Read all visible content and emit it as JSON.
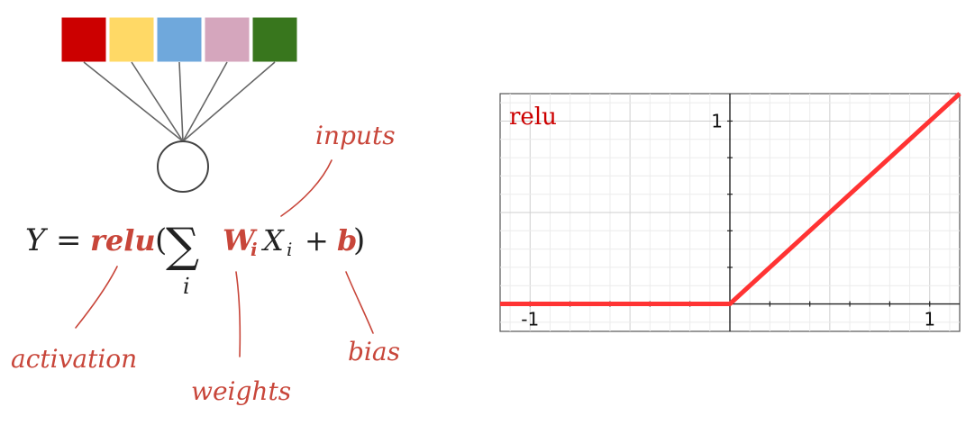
{
  "neuron": {
    "input_colors": [
      "#cc0000",
      "#ffd966",
      "#6fa8dc",
      "#d5a6bd",
      "#38761d"
    ],
    "line_color": "#666666",
    "node_stroke": "#444444"
  },
  "formula": {
    "lhs": "Y",
    "equals": "=",
    "activation_fn": "relu",
    "open_paren": "(",
    "sum_symbol": "∑",
    "sum_index": "i",
    "weight": "W",
    "weight_sub": "i",
    "input": "X",
    "input_sub": "i",
    "plus": "+",
    "bias": "b",
    "close_paren": ")",
    "highlight_color": "#c8463a"
  },
  "annotations": {
    "inputs": "inputs",
    "activation": "activation",
    "weights": "weights",
    "bias": "bias"
  },
  "chart_data": {
    "type": "line",
    "title": "relu",
    "title_color": "#cc0000",
    "line_color": "#ff3333",
    "xlim": [
      -1.15,
      1.15
    ],
    "ylim": [
      -0.15,
      1.15
    ],
    "x_tick_labels": [
      "-1",
      "1"
    ],
    "y_tick_labels": [
      "1"
    ],
    "grid": true,
    "series": [
      {
        "x": [
          -1.15,
          0,
          1.15
        ],
        "y": [
          0,
          0,
          1.15
        ]
      }
    ]
  }
}
